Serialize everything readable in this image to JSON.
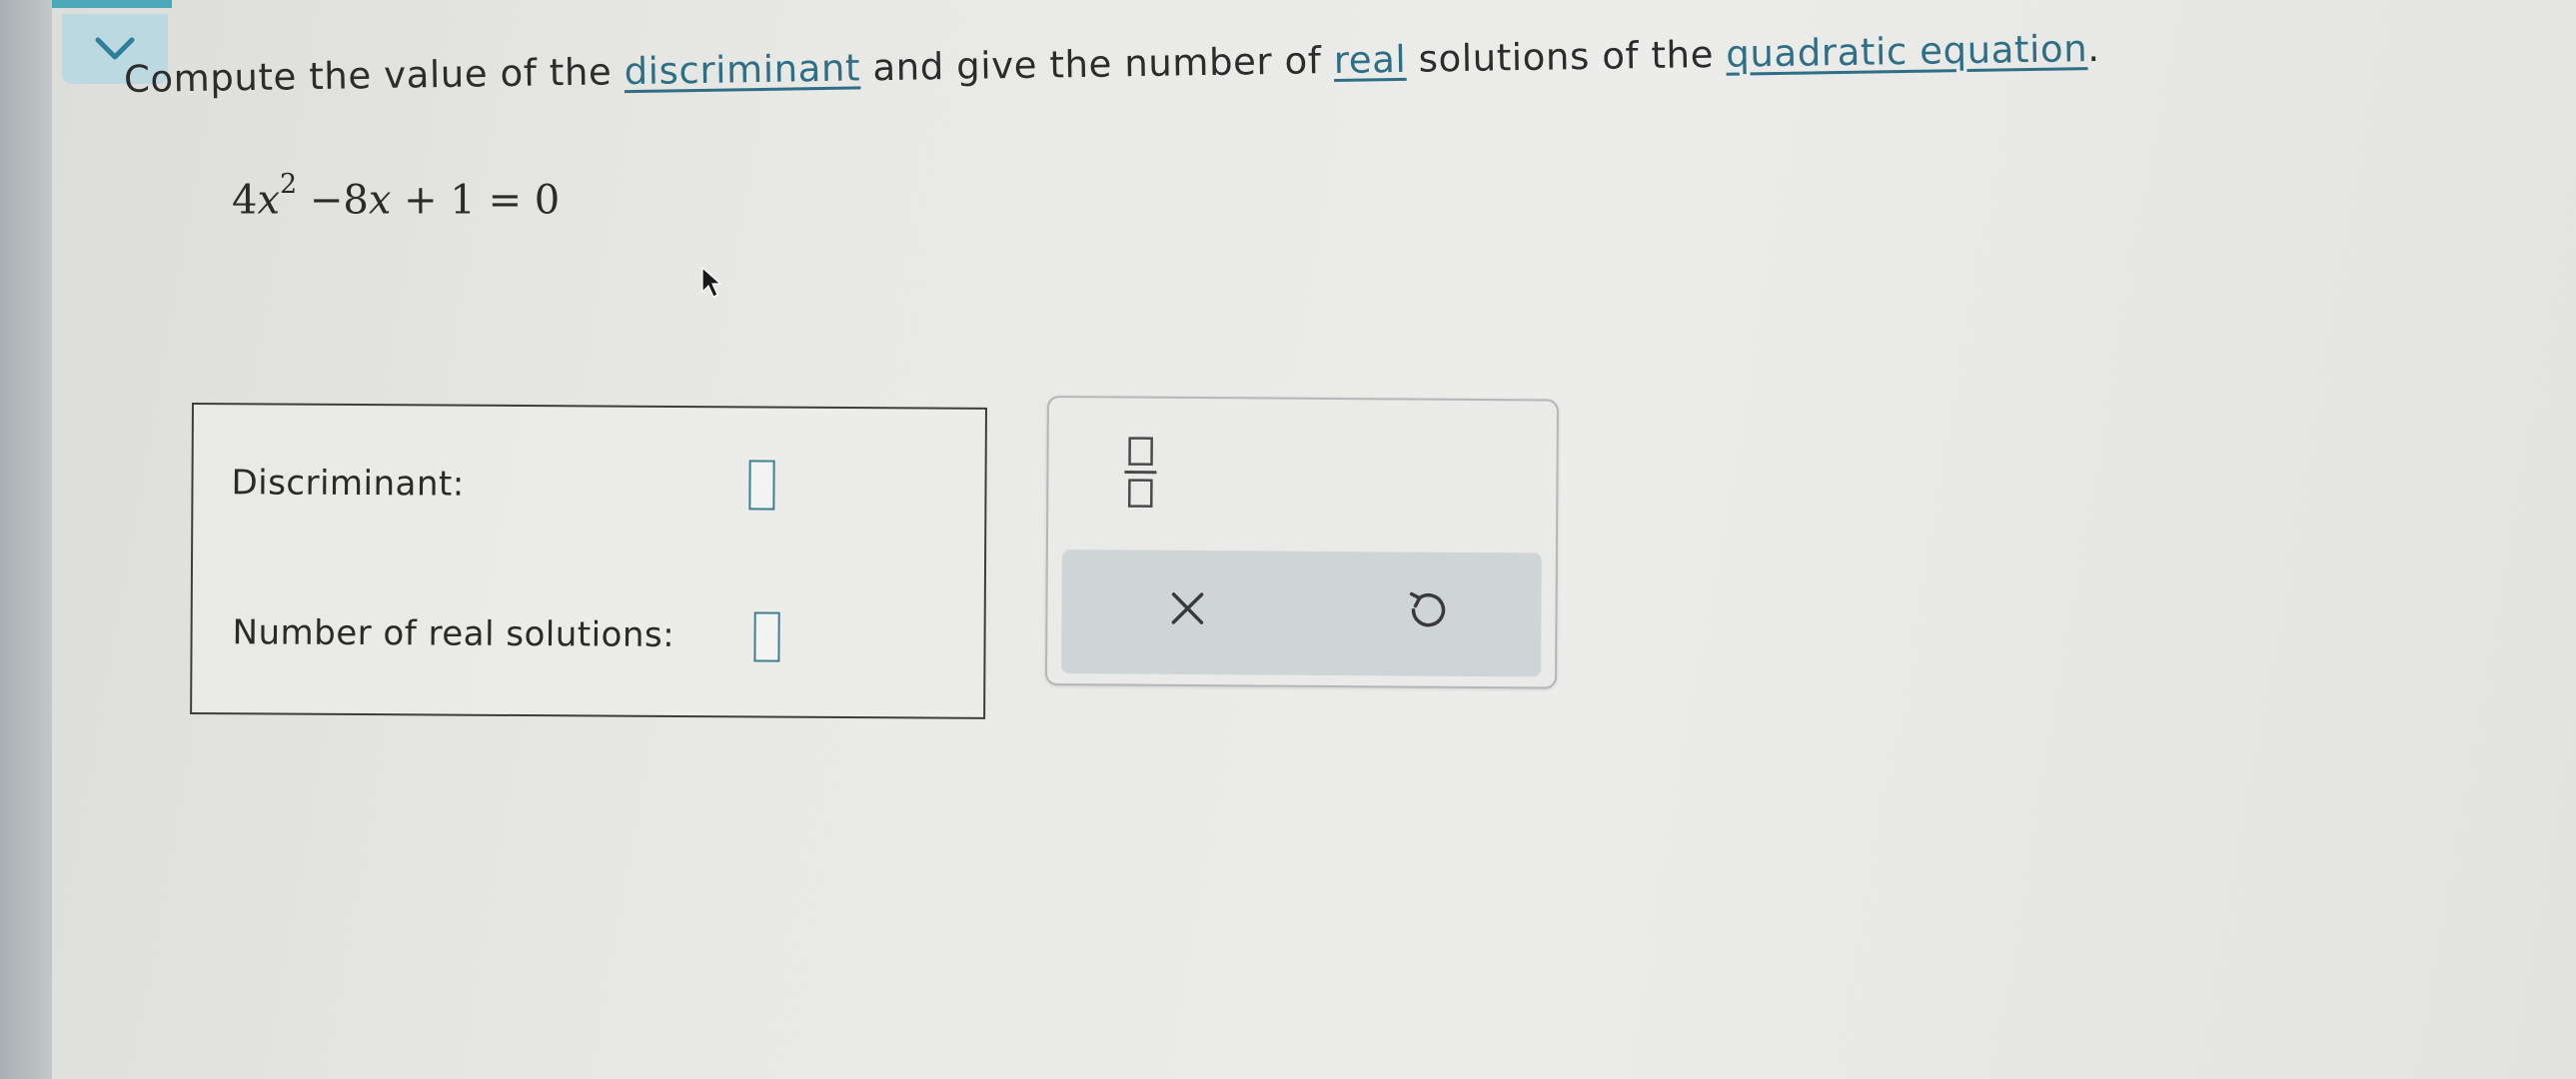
{
  "question": {
    "prefix": "Compute the value of the ",
    "link_discriminant": "discriminant",
    "middle1": " and give the number of ",
    "link_real": "real",
    "middle2": " solutions of the ",
    "link_quadratic": "quadratic equation",
    "suffix": "."
  },
  "equation": {
    "coef_a": "4",
    "var": "x",
    "exponent": "2",
    "rest": " −8",
    "var2": "x",
    "tail": " + 1 = 0"
  },
  "answer": {
    "discriminant_label": "Discriminant:",
    "discriminant_value": "",
    "solutions_label": "Number of real solutions:",
    "solutions_value": ""
  },
  "toolbox": {
    "fraction_icon": "fraction-icon",
    "clear_icon": "close-icon",
    "undo_icon": "undo-icon"
  },
  "colors": {
    "link": "#2f6f86",
    "accent": "#4aa8b8",
    "toolbar_bg": "#cfd4d6"
  }
}
